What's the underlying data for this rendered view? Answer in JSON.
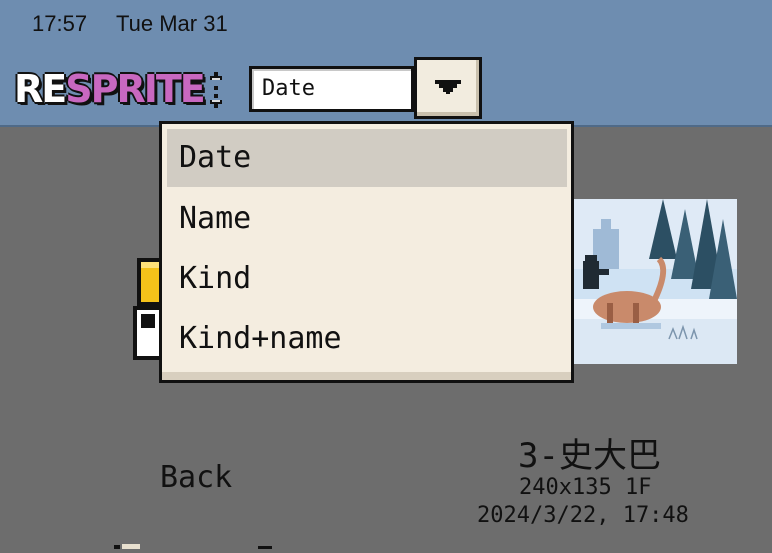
{
  "status_bar": {
    "time": "17:57",
    "date": "Tue Mar 31"
  },
  "app": {
    "logo_part1": "RE",
    "logo_part2": "SPRITE"
  },
  "sort": {
    "current_value": "Date",
    "order_icon": "sort-order-arrows-icon",
    "dropdown_icon": "triangle-down-icon",
    "options": [
      "Date",
      "Name",
      "Kind",
      "Kind+name"
    ],
    "selected_index": 0
  },
  "browser": {
    "back_label": "Back",
    "file": {
      "name": "3-史大巴",
      "info": "240x135 1F",
      "date": "2024/3/22, 17:48"
    }
  },
  "colors": {
    "topbar": "#6e8db0",
    "background": "#6d6d6d",
    "menu_bg": "#f4ede0",
    "menu_selected": "#d1ccc3",
    "logo_accent": "#c868c0"
  }
}
